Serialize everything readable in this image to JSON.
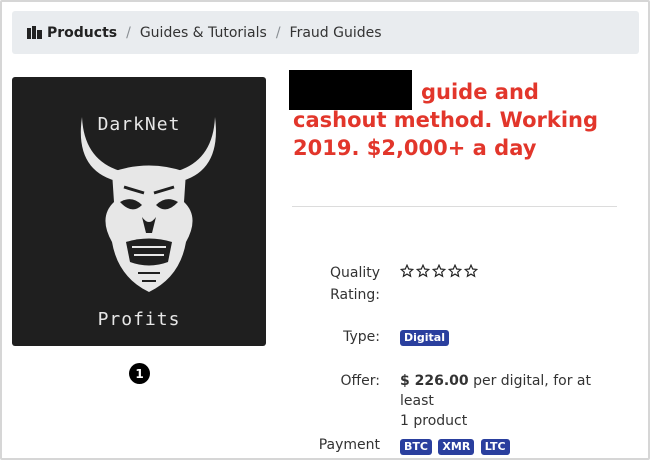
{
  "breadcrumb": {
    "home_label": "Products",
    "items": [
      "Guides & Tutorials",
      "Fraud Guides"
    ]
  },
  "product": {
    "image_text_top": "DarkNet",
    "image_text_bottom": "Profits",
    "image_index": "1",
    "title_line1": "guide and",
    "title_line2": "cashout method. Working",
    "title_line3": "2019. $2,000+ a day",
    "title_color": "#e2362b"
  },
  "details": {
    "quality_label_1": "Quality",
    "quality_label_2": "Rating:",
    "rating_stars": 0,
    "rating_max": 5,
    "type_label": "Type:",
    "type_value": "Digital",
    "offer_label": "Offer:",
    "offer_price": "$ 226.00",
    "offer_rest_1": " per digital, for at least",
    "offer_rest_2": "1 product",
    "payment_label": "Payment",
    "payment_methods": [
      "BTC",
      "XMR",
      "LTC"
    ]
  },
  "colors": {
    "badge": "#2a3f9e",
    "breadcrumb_bg": "#e9ecef"
  }
}
